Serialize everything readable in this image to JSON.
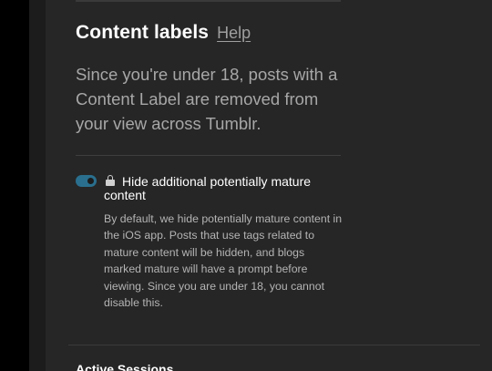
{
  "content_labels": {
    "heading": "Content labels",
    "help_link": "Help",
    "description": "Since you're under 18, posts with a Content Label are removed from your view across Tumblr."
  },
  "mature_setting": {
    "toggle_state": "on",
    "toggle_color": "#2a6f8e",
    "lock_icon": "lock-icon",
    "title": "Hide additional potentially mature content",
    "help_text": "By default, we hide potentially mature content in the iOS app. Posts that use tags related to mature content will be hidden, and blogs marked mature will have a prompt before viewing. Since you are under 18, you cannot disable this."
  },
  "next_section": {
    "heading": "Active Sessions"
  }
}
